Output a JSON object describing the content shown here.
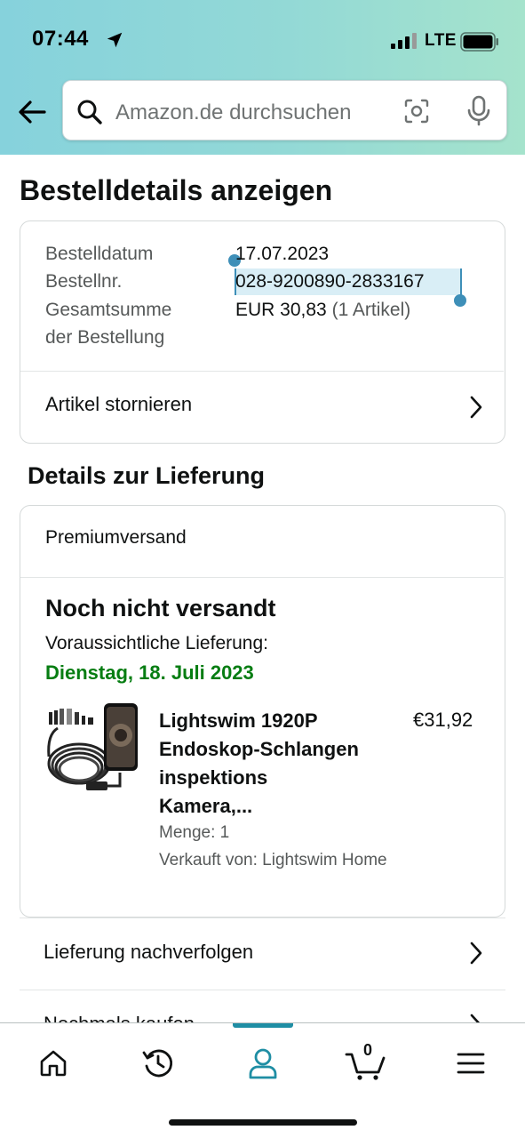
{
  "status_bar": {
    "time": "07:44",
    "network": "LTE",
    "icons": [
      "location-arrow-icon",
      "signal-bars-icon",
      "battery-icon"
    ]
  },
  "header": {
    "back_icon": "arrow-left-icon",
    "search_placeholder": "Amazon.de durchsuchen",
    "camera_icon": "camera-scan-icon",
    "mic_icon": "microphone-icon"
  },
  "page": {
    "title": "Bestelldetails anzeigen"
  },
  "order": {
    "date_label": "Bestelldatum",
    "date_value": "17.07.2023",
    "number_label": "Bestellnr.",
    "number_value": "028-9200890-2833167",
    "total_label_line1": "Gesamtsumme",
    "total_label_line2": "der Bestellung",
    "total_value": "EUR 30,83",
    "total_items": "(1 Artikel)",
    "cancel_label": "Artikel stornieren"
  },
  "delivery": {
    "section_title": "Details zur Lieferung",
    "shipping_method": "Premiumversand",
    "status": "Noch nicht versandt",
    "expected_label": "Voraussichtliche Lieferung:",
    "expected_date": "Dienstag, 18. Juli 2023",
    "expected_date_color": "#067d12",
    "product": {
      "title_lines": [
        "Lightswim 1920P",
        "Endoskop-Schlangen",
        "inspektions",
        "Kamera,..."
      ],
      "price": "€31,92",
      "quantity": "Menge: 1",
      "seller": "Verkauft von: Lightswim Home"
    }
  },
  "actions": {
    "track": "Lieferung nachverfolgen",
    "buy_again": "Nochmals kaufen"
  },
  "tabbar": {
    "active_tab": "account",
    "accent_color": "#1f8ea4",
    "cart_count": "0",
    "tabs": [
      "home-icon",
      "history-icon",
      "account-icon",
      "cart-icon",
      "menu-icon"
    ]
  }
}
